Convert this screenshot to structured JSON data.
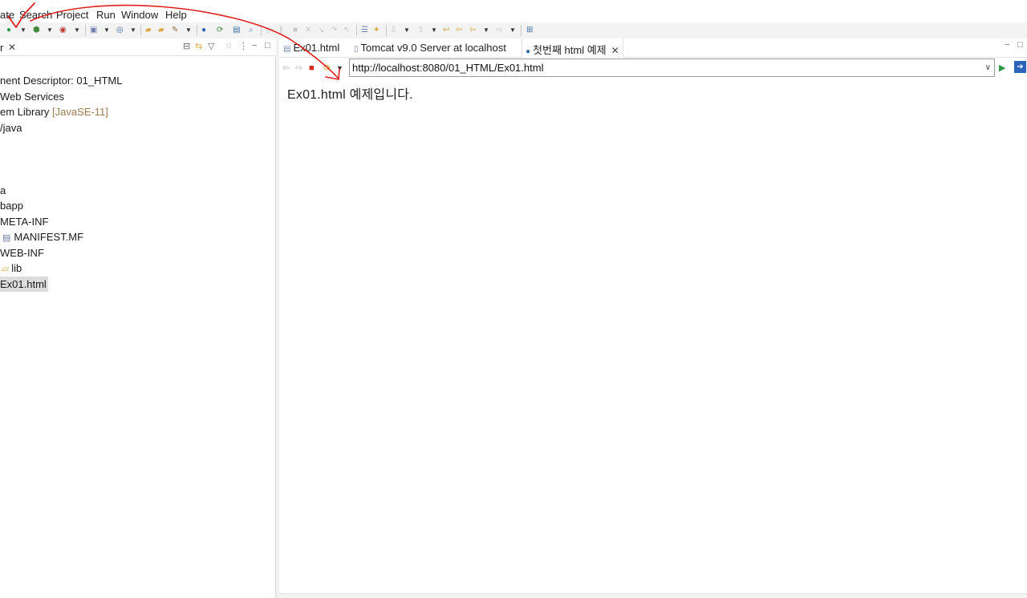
{
  "menu": {
    "items": [
      "ate",
      "Search",
      "Project",
      "Run",
      "Window",
      "Help"
    ]
  },
  "toolbar": {
    "icons": [
      "run-icon",
      "debug-icon",
      "coverage-icon",
      "new-server-icon",
      "new-web-project-icon",
      "open-folder-icon",
      "build-icon",
      "globe-icon",
      "refresh-icon",
      "console-icon",
      "search-icon",
      "step-into-icon",
      "step-over-icon",
      "terminate-icon",
      "disconnect-icon",
      "step-return-icon",
      "back-icon",
      "forward-icon",
      "open-perspective-icon"
    ]
  },
  "left_panel": {
    "title": "r",
    "close": "✕",
    "tree": [
      {
        "label": "nent Descriptor: 01_HTML",
        "suffix": ""
      },
      {
        "label": "Web Services",
        "suffix": ""
      },
      {
        "label": "em Library ",
        "suffix": "[JavaSE-11]"
      },
      {
        "label": "/java",
        "suffix": ""
      },
      {
        "label": "a",
        "suffix": ""
      },
      {
        "label": "bapp",
        "suffix": ""
      },
      {
        "label": "META-INF",
        "suffix": ""
      },
      {
        "label": "MANIFEST.MF",
        "suffix": ""
      },
      {
        "label": "WEB-INF",
        "suffix": ""
      },
      {
        "label": "lib",
        "suffix": ""
      },
      {
        "label": "Ex01.html",
        "suffix": ""
      }
    ]
  },
  "editor": {
    "tabs": [
      {
        "label": "Ex01.html",
        "icon": "file-icon",
        "active": false
      },
      {
        "label": "Tomcat v9.0 Server at localhost",
        "icon": "server-icon",
        "active": false
      },
      {
        "label": "첫번째 html 예제",
        "icon": "globe-icon",
        "active": true
      }
    ],
    "close": "✕",
    "url": "http://localhost:8080/01_HTML/Ex01.html",
    "page_text": "Ex01.html 예제입니다."
  },
  "colors": {
    "annotation": "#e0201c",
    "accent": "#2b63b8",
    "go": "#2e9a45",
    "library_suffix": "#9a7b4f"
  }
}
